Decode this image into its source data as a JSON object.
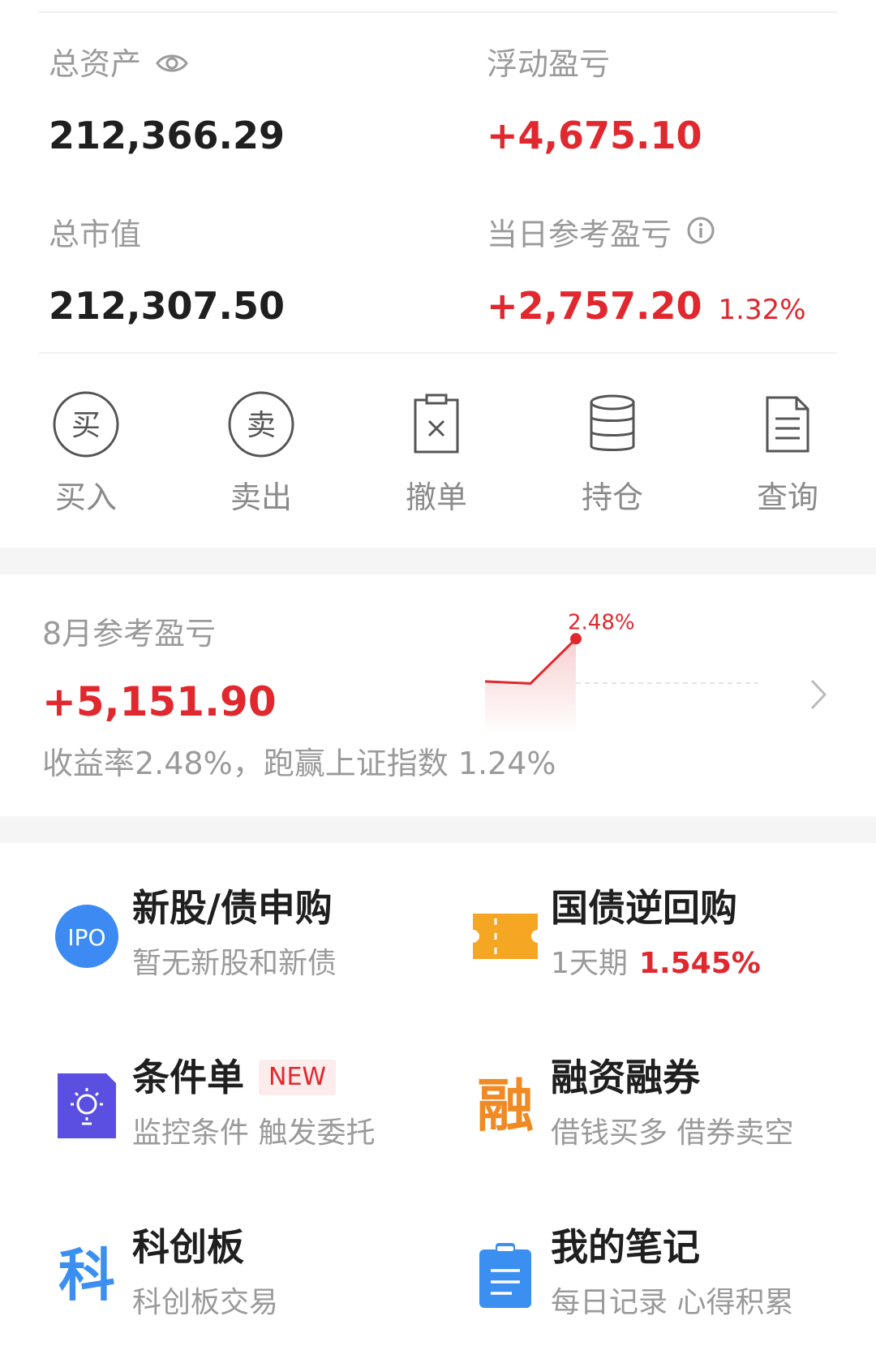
{
  "summary": {
    "total_assets_label": "总资产",
    "total_assets": "212,366.29",
    "floating_pl_label": "浮动盈亏",
    "floating_pl": "+4,675.10",
    "market_value_label": "总市值",
    "market_value": "212,307.50",
    "daily_pl_label": "当日参考盈亏",
    "daily_pl": "+2,757.20",
    "daily_pl_pct": "1.32%"
  },
  "actions": [
    {
      "label": "买入",
      "icon_char": "买",
      "icon": "buy-icon"
    },
    {
      "label": "卖出",
      "icon_char": "卖",
      "icon": "sell-icon"
    },
    {
      "label": "撤单",
      "icon": "cancel-order-icon"
    },
    {
      "label": "持仓",
      "icon": "holdings-icon"
    },
    {
      "label": "查询",
      "icon": "query-document-icon"
    }
  ],
  "monthly": {
    "label": "8月参考盈亏",
    "value": "+5,151.90",
    "summary_text": "收益率2.48%，跑赢上证指数 1.24%"
  },
  "chart_data": {
    "type": "line",
    "series": [
      {
        "values": [
          0.4,
          0.3,
          2.48
        ]
      }
    ],
    "end_label": "2.48%",
    "baseline_dashed": true
  },
  "features": {
    "ipo": {
      "title": "新股/债申购",
      "subtitle": "暂无新股和新债",
      "icon_text": "IPO"
    },
    "repo": {
      "title": "国债逆回购",
      "subtitle_prefix": "1天期",
      "subtitle_rate": "1.545%"
    },
    "conditional": {
      "title": "条件单",
      "badge": "NEW",
      "subtitle": "监控条件 触发委托"
    },
    "margin": {
      "title": "融资融券",
      "subtitle": "借钱买多 借券卖空",
      "icon_char": "融"
    },
    "star": {
      "title": "科创板",
      "subtitle": "科创板交易",
      "icon_char": "科"
    },
    "notes": {
      "title": "我的笔记",
      "subtitle": "每日记录 心得积累"
    }
  },
  "colors": {
    "red": "#e0282e",
    "ipo_blue": "#3d8bf2",
    "ticket_orange": "#f5a623",
    "purple": "#5a4fe0",
    "orange_text": "#f08a24",
    "note_blue": "#3a8ff0"
  }
}
